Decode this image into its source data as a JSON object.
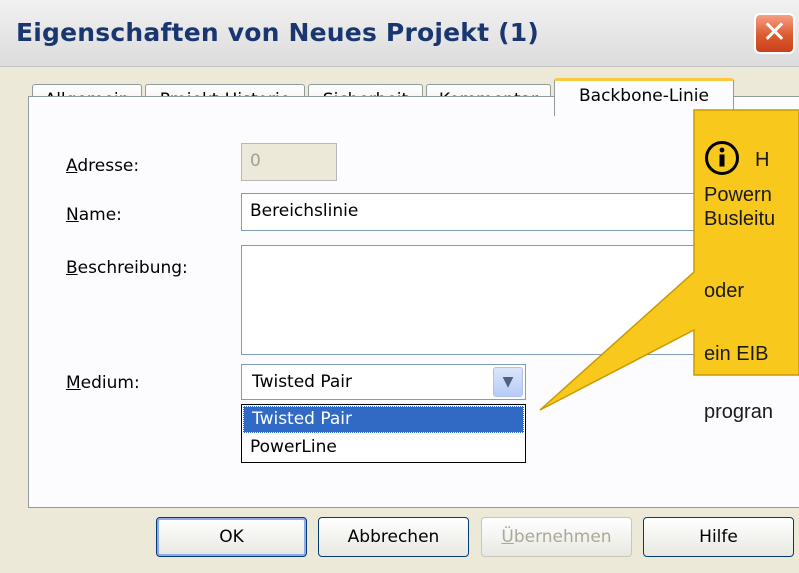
{
  "window": {
    "title": "Eigenschaften von Neues Projekt (1)",
    "close_glyph": "✕"
  },
  "tabs": [
    {
      "label": "Allgemein",
      "active": false
    },
    {
      "label": "Projekt-Historie",
      "active": false
    },
    {
      "label": "Sicherheit",
      "active": false
    },
    {
      "label": "Kommentar",
      "active": false
    },
    {
      "label": "Backbone-Linie",
      "active": true
    }
  ],
  "form": {
    "adresse": {
      "label_mnemonic": "A",
      "label_rest": "dresse:",
      "value": "0"
    },
    "name": {
      "label_mnemonic": "N",
      "label_rest": "ame:",
      "value": "Bereichslinie"
    },
    "beschreibung": {
      "label_mnemonic": "B",
      "label_rest": "eschreibung:",
      "value": ""
    },
    "medium": {
      "label_mnemonic": "M",
      "label_rest": "edium:",
      "selected": "Twisted Pair",
      "options": [
        "Twisted Pair",
        "PowerLine"
      ]
    }
  },
  "buttons": {
    "ok": "OK",
    "cancel": "Abbrechen",
    "apply_mnemonic": "Ü",
    "apply_rest": "bernehmen",
    "help": "Hilfe"
  },
  "callout": {
    "icon": "info-icon",
    "lines": [
      "H",
      "Powern",
      "Busleitu",
      "oder",
      "ein EIB",
      "progran"
    ]
  },
  "colors": {
    "callout_fill": "#f8c81c",
    "callout_border": "#c89a00",
    "selection": "#316ac5",
    "title_text": "#1a3670"
  }
}
